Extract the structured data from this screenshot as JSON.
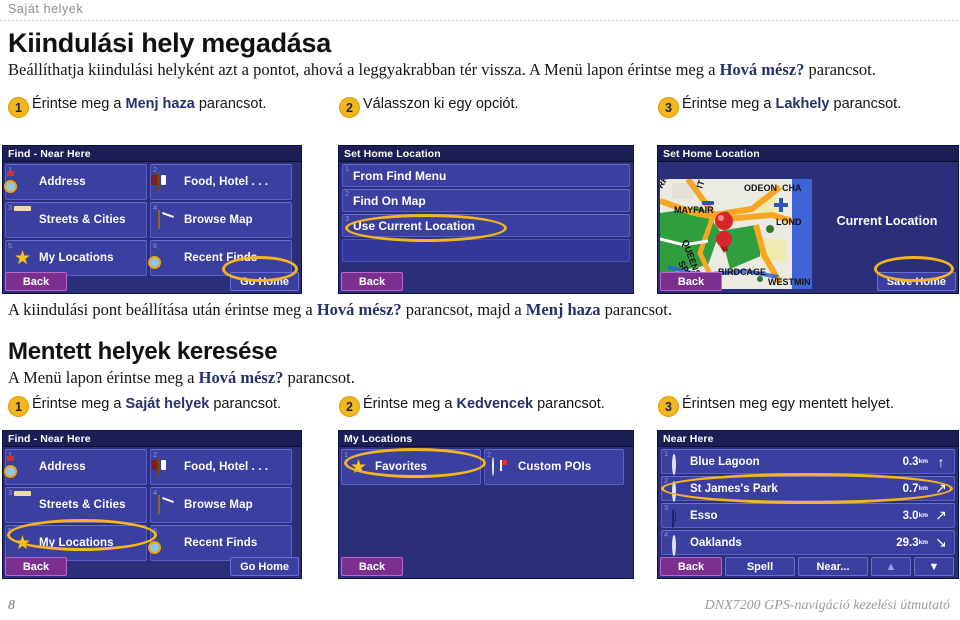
{
  "running_head": "Saját helyek",
  "section1": {
    "title": "Kiindulási hely megadása",
    "intro": "Beállíthatja kiindulási helyként azt a pontot, ahová a leggyakrabban tér vissza. A Menü lapon érintse meg a ",
    "intro_bold": "Hová mész?",
    "intro_tail": " parancsot.",
    "steps": [
      {
        "num": "1",
        "pre": "Érintse meg a ",
        "bold": "Menj haza",
        "post": " parancsot."
      },
      {
        "num": "2",
        "pre": "Válasszon ki egy opciót.",
        "bold": "",
        "post": ""
      },
      {
        "num": "3",
        "pre": "Érintse meg a ",
        "bold": "Lakhely",
        "post": " parancsot."
      }
    ],
    "note_pre": "A kiindulási pont beállítása után érintse meg a ",
    "note_b1": "Hová mész?",
    "note_mid": " parancsot, majd a ",
    "note_b2": "Menj haza",
    "note_tail": " parancsot."
  },
  "section2": {
    "title": "Mentett helyek keresése",
    "intro": "A Menü lapon érintse meg a ",
    "intro_bold": "Hová mész?",
    "intro_tail": " parancsot.",
    "steps": [
      {
        "num": "1",
        "pre": "Érintse meg a ",
        "bold": "Saját helyek",
        "post": " parancsot."
      },
      {
        "num": "2",
        "pre": "Érintse meg a ",
        "bold": "Kedvencek",
        "post": " parancsot."
      },
      {
        "num": "3",
        "pre": "Érintsen meg egy mentett helyet.",
        "bold": "",
        "post": ""
      }
    ]
  },
  "screens": {
    "find_near_here_1": {
      "title": "Find - Near Here",
      "tiles": [
        {
          "idx": "1",
          "label": "Address",
          "icon": "address-icon"
        },
        {
          "idx": "2",
          "label": "Food, Hotel . . .",
          "icon": "food-hotel-icon"
        },
        {
          "idx": "3",
          "label": "Streets & Cities",
          "icon": "streets-cities-icon"
        },
        {
          "idx": "4",
          "label": "Browse Map",
          "icon": "browse-map-icon"
        },
        {
          "idx": "5",
          "label": "My Locations",
          "icon": "star-icon"
        },
        {
          "idx": "6",
          "label": "Recent Finds",
          "icon": "recent-finds-icon"
        }
      ],
      "back": "Back",
      "go_home": "Go Home"
    },
    "set_home_location": {
      "title": "Set Home Location",
      "rows": [
        {
          "idx": "1",
          "label": "From Find Menu"
        },
        {
          "idx": "2",
          "label": "Find On Map"
        },
        {
          "idx": "3",
          "label": "Use Current Location"
        }
      ],
      "back": "Back"
    },
    "set_home_map": {
      "title": "Set Home Location",
      "current_location": "Current Location",
      "map_labels": [
        "ODEON",
        "MAYFAIR",
        "QUEENS",
        "BIRDCAGE",
        "WESTMIN",
        "LOND",
        "CHA",
        "SPUR",
        "RK",
        "IT"
      ],
      "scale": "300",
      "back": "Back",
      "save_home": "Save Home"
    },
    "find_near_here_2": {
      "title": "Find - Near Here",
      "tiles": [
        {
          "idx": "1",
          "label": "Address",
          "icon": "address-icon"
        },
        {
          "idx": "2",
          "label": "Food, Hotel . . .",
          "icon": "food-hotel-icon"
        },
        {
          "idx": "3",
          "label": "Streets & Cities",
          "icon": "streets-cities-icon"
        },
        {
          "idx": "4",
          "label": "Browse Map",
          "icon": "browse-map-icon"
        },
        {
          "idx": "5",
          "label": "My Locations",
          "icon": "star-icon"
        },
        {
          "idx": "6",
          "label": "Recent Finds",
          "icon": "recent-finds-icon"
        }
      ],
      "back": "Back",
      "go_home": "Go Home"
    },
    "my_locations": {
      "title": "My Locations",
      "tiles": [
        {
          "idx": "1",
          "label": "Favorites",
          "icon": "star-icon"
        },
        {
          "idx": "2",
          "label": "Custom POIs",
          "icon": "custom-poi-icon"
        }
      ],
      "back": "Back"
    },
    "near_here": {
      "title": "Near Here",
      "rows": [
        {
          "idx": "1",
          "name": "Blue Lagoon",
          "dist": "0.3",
          "unit": "km",
          "arrow": "up",
          "icon": "poi-dot-icon"
        },
        {
          "idx": "2",
          "name": "St James's Park",
          "dist": "0.7",
          "unit": "km",
          "arrow": "up-right",
          "icon": "poi-dot-icon"
        },
        {
          "idx": "3",
          "name": "Esso",
          "dist": "3.0",
          "unit": "km",
          "arrow": "up-right",
          "icon": "gas-station-icon"
        },
        {
          "idx": "4",
          "name": "Oaklands",
          "dist": "29.3",
          "unit": "km",
          "arrow": "down-right",
          "icon": "poi-dot-icon"
        }
      ],
      "back": "Back",
      "spell": "Spell",
      "near": "Near...",
      "scroll_up": "▲",
      "scroll_down": "▼"
    }
  },
  "footer": {
    "page_number": "8",
    "manual_title": "DNX7200 GPS-navigáció kezelési útmutató"
  },
  "colors": {
    "accent_gold": "#f5b51d",
    "heading_blue": "#24316b",
    "screen_bg": "#2b2f7a",
    "tile_bg": "#3b3fa0",
    "back_button": "#7b2f8e"
  }
}
